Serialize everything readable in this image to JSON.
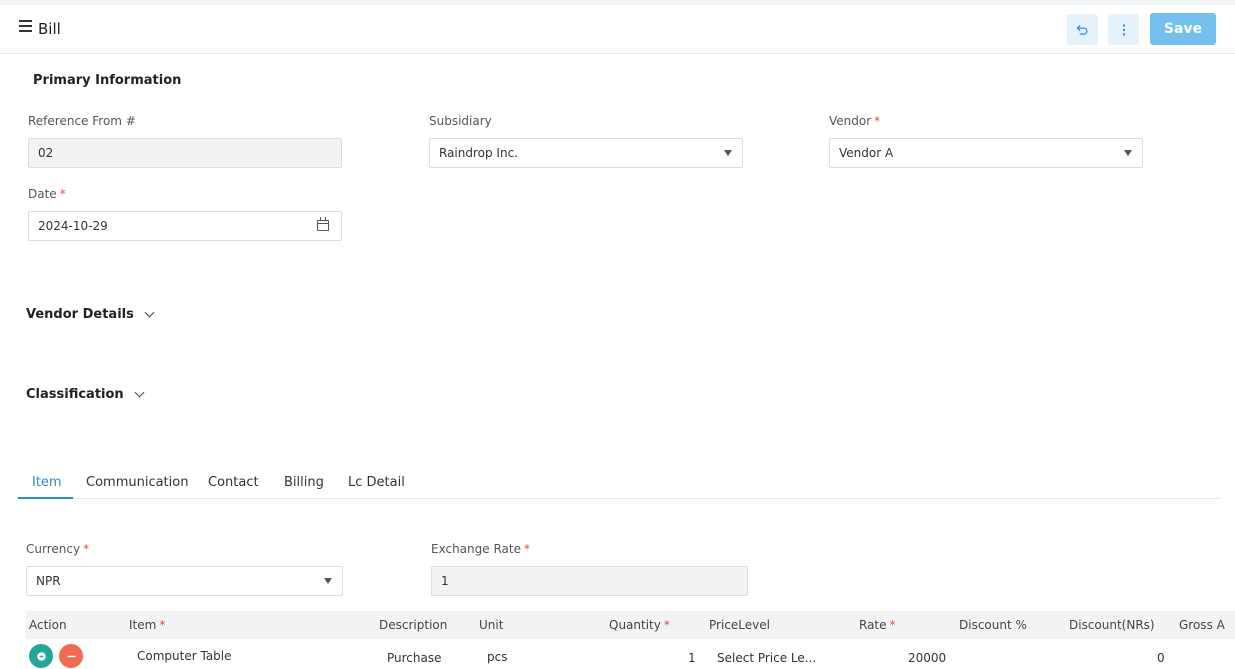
{
  "header": {
    "title": "Bill",
    "save_label": "Save"
  },
  "primary": {
    "title": "Primary Information",
    "reference": {
      "label": "Reference From #",
      "value": "02"
    },
    "subsidiary": {
      "label": "Subsidiary",
      "value": "Raindrop Inc."
    },
    "vendor": {
      "label": "Vendor",
      "required_mark": "*",
      "value": "Vendor A"
    },
    "date": {
      "label": "Date",
      "required_mark": "*",
      "value": "2024-10-29"
    }
  },
  "sections": {
    "vendor_details": "Vendor Details",
    "classification": "Classification"
  },
  "tabs": [
    "Item",
    "Communication",
    "Contact",
    "Billing",
    "Lc Detail"
  ],
  "item": {
    "currency": {
      "label": "Currency",
      "required_mark": "*",
      "value": "NPR"
    },
    "exchange_rate": {
      "label": "Exchange Rate",
      "required_mark": "*",
      "value": "1"
    }
  },
  "table": {
    "headers": {
      "action": "Action",
      "item": "Item",
      "description": "Description",
      "unit": "Unit",
      "quantity": "Quantity",
      "price_level": "PriceLevel",
      "rate": "Rate",
      "discount_pct": "Discount %",
      "discount_nrs": "Discount(NRs)",
      "gross": "Gross A"
    },
    "required_mark": "*",
    "rows": [
      {
        "item": "Computer Table",
        "description": "Purchase",
        "unit": "pcs",
        "quantity": "1",
        "price_level": "Select Price Le...",
        "rate": "20000",
        "discount_nrs": "0"
      }
    ]
  },
  "colors": {
    "accent": "#2f8bd0",
    "save": "#74bfee",
    "add": "#26a69a",
    "remove": "#ef6b4f",
    "required": "#e24c3c"
  },
  "icons": {
    "menu": "hamburger-icon",
    "undo": "undo-icon",
    "more": "more-vertical-icon",
    "calendar": "calendar-icon"
  }
}
